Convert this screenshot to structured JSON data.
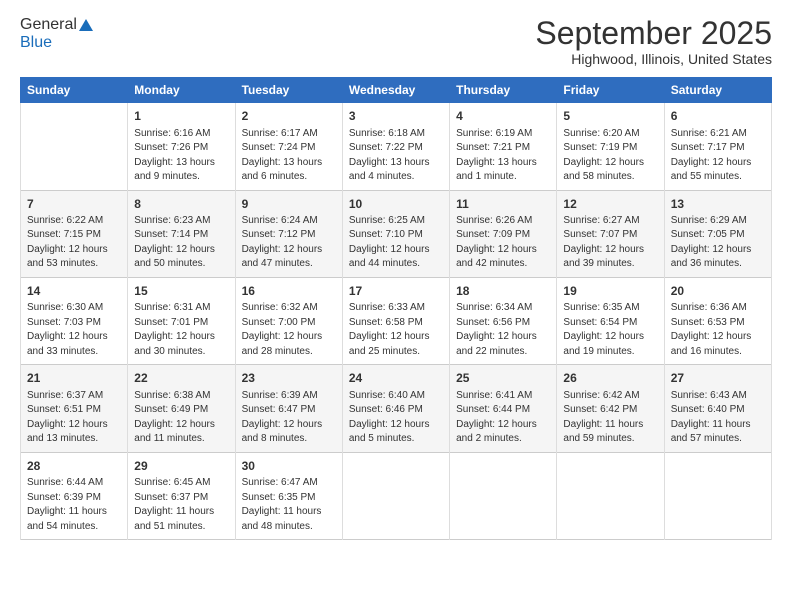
{
  "header": {
    "logo_line1": "General",
    "logo_line2": "Blue",
    "main_title": "September 2025",
    "subtitle": "Highwood, Illinois, United States"
  },
  "days_of_week": [
    "Sunday",
    "Monday",
    "Tuesday",
    "Wednesday",
    "Thursday",
    "Friday",
    "Saturday"
  ],
  "weeks": [
    [
      {
        "day": "",
        "info": ""
      },
      {
        "day": "1",
        "info": "Sunrise: 6:16 AM\nSunset: 7:26 PM\nDaylight: 13 hours\nand 9 minutes."
      },
      {
        "day": "2",
        "info": "Sunrise: 6:17 AM\nSunset: 7:24 PM\nDaylight: 13 hours\nand 6 minutes."
      },
      {
        "day": "3",
        "info": "Sunrise: 6:18 AM\nSunset: 7:22 PM\nDaylight: 13 hours\nand 4 minutes."
      },
      {
        "day": "4",
        "info": "Sunrise: 6:19 AM\nSunset: 7:21 PM\nDaylight: 13 hours\nand 1 minute."
      },
      {
        "day": "5",
        "info": "Sunrise: 6:20 AM\nSunset: 7:19 PM\nDaylight: 12 hours\nand 58 minutes."
      },
      {
        "day": "6",
        "info": "Sunrise: 6:21 AM\nSunset: 7:17 PM\nDaylight: 12 hours\nand 55 minutes."
      }
    ],
    [
      {
        "day": "7",
        "info": "Sunrise: 6:22 AM\nSunset: 7:15 PM\nDaylight: 12 hours\nand 53 minutes."
      },
      {
        "day": "8",
        "info": "Sunrise: 6:23 AM\nSunset: 7:14 PM\nDaylight: 12 hours\nand 50 minutes."
      },
      {
        "day": "9",
        "info": "Sunrise: 6:24 AM\nSunset: 7:12 PM\nDaylight: 12 hours\nand 47 minutes."
      },
      {
        "day": "10",
        "info": "Sunrise: 6:25 AM\nSunset: 7:10 PM\nDaylight: 12 hours\nand 44 minutes."
      },
      {
        "day": "11",
        "info": "Sunrise: 6:26 AM\nSunset: 7:09 PM\nDaylight: 12 hours\nand 42 minutes."
      },
      {
        "day": "12",
        "info": "Sunrise: 6:27 AM\nSunset: 7:07 PM\nDaylight: 12 hours\nand 39 minutes."
      },
      {
        "day": "13",
        "info": "Sunrise: 6:29 AM\nSunset: 7:05 PM\nDaylight: 12 hours\nand 36 minutes."
      }
    ],
    [
      {
        "day": "14",
        "info": "Sunrise: 6:30 AM\nSunset: 7:03 PM\nDaylight: 12 hours\nand 33 minutes."
      },
      {
        "day": "15",
        "info": "Sunrise: 6:31 AM\nSunset: 7:01 PM\nDaylight: 12 hours\nand 30 minutes."
      },
      {
        "day": "16",
        "info": "Sunrise: 6:32 AM\nSunset: 7:00 PM\nDaylight: 12 hours\nand 28 minutes."
      },
      {
        "day": "17",
        "info": "Sunrise: 6:33 AM\nSunset: 6:58 PM\nDaylight: 12 hours\nand 25 minutes."
      },
      {
        "day": "18",
        "info": "Sunrise: 6:34 AM\nSunset: 6:56 PM\nDaylight: 12 hours\nand 22 minutes."
      },
      {
        "day": "19",
        "info": "Sunrise: 6:35 AM\nSunset: 6:54 PM\nDaylight: 12 hours\nand 19 minutes."
      },
      {
        "day": "20",
        "info": "Sunrise: 6:36 AM\nSunset: 6:53 PM\nDaylight: 12 hours\nand 16 minutes."
      }
    ],
    [
      {
        "day": "21",
        "info": "Sunrise: 6:37 AM\nSunset: 6:51 PM\nDaylight: 12 hours\nand 13 minutes."
      },
      {
        "day": "22",
        "info": "Sunrise: 6:38 AM\nSunset: 6:49 PM\nDaylight: 12 hours\nand 11 minutes."
      },
      {
        "day": "23",
        "info": "Sunrise: 6:39 AM\nSunset: 6:47 PM\nDaylight: 12 hours\nand 8 minutes."
      },
      {
        "day": "24",
        "info": "Sunrise: 6:40 AM\nSunset: 6:46 PM\nDaylight: 12 hours\nand 5 minutes."
      },
      {
        "day": "25",
        "info": "Sunrise: 6:41 AM\nSunset: 6:44 PM\nDaylight: 12 hours\nand 2 minutes."
      },
      {
        "day": "26",
        "info": "Sunrise: 6:42 AM\nSunset: 6:42 PM\nDaylight: 11 hours\nand 59 minutes."
      },
      {
        "day": "27",
        "info": "Sunrise: 6:43 AM\nSunset: 6:40 PM\nDaylight: 11 hours\nand 57 minutes."
      }
    ],
    [
      {
        "day": "28",
        "info": "Sunrise: 6:44 AM\nSunset: 6:39 PM\nDaylight: 11 hours\nand 54 minutes."
      },
      {
        "day": "29",
        "info": "Sunrise: 6:45 AM\nSunset: 6:37 PM\nDaylight: 11 hours\nand 51 minutes."
      },
      {
        "day": "30",
        "info": "Sunrise: 6:47 AM\nSunset: 6:35 PM\nDaylight: 11 hours\nand 48 minutes."
      },
      {
        "day": "",
        "info": ""
      },
      {
        "day": "",
        "info": ""
      },
      {
        "day": "",
        "info": ""
      },
      {
        "day": "",
        "info": ""
      }
    ]
  ]
}
